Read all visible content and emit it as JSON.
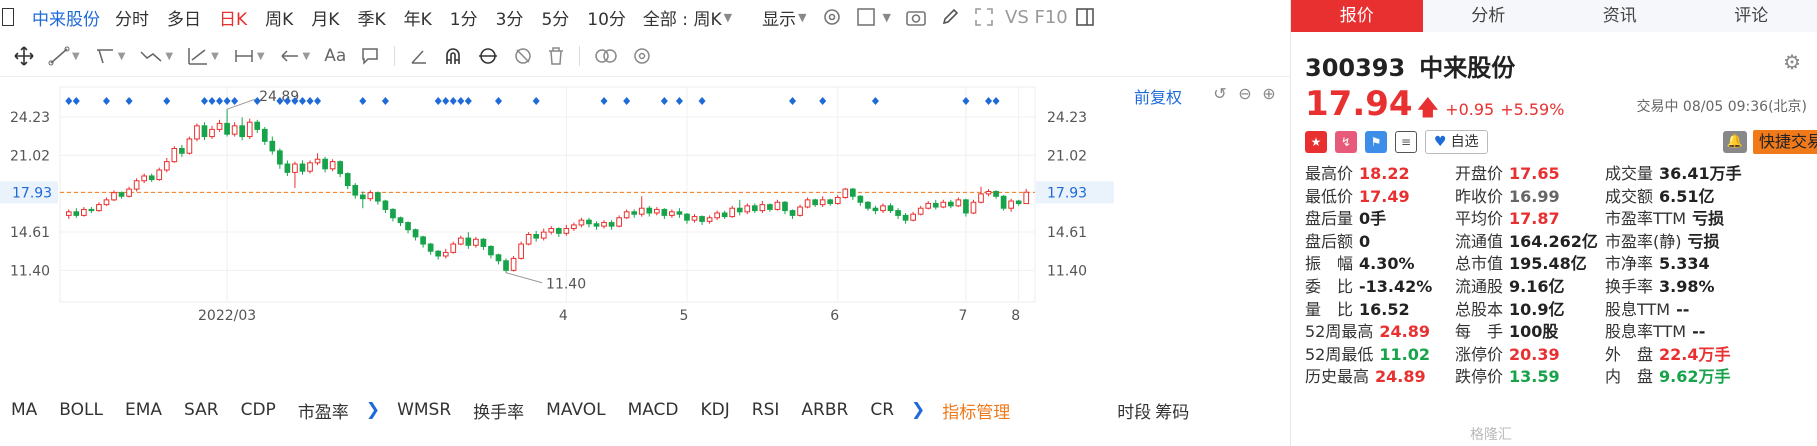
{
  "topbar": {
    "stock_name": "中来股份",
    "tabs": [
      "分时",
      "多日",
      "日K",
      "周K",
      "月K",
      "季K",
      "年K",
      "1分",
      "3分",
      "5分",
      "10分"
    ],
    "active_tab": "日K",
    "period_select": "全部 : 周K",
    "display_select": "显示",
    "vs_label": "VS F10"
  },
  "toolbar": {
    "aa_label": "Aa"
  },
  "chart": {
    "restore_label": "前复权",
    "accent": "#e93030",
    "down_color": "#16a34a",
    "marker_color": "#1e6ad8"
  },
  "chart_data": {
    "type": "candlestick",
    "yticks": [
      "24.23",
      "21.02",
      "17.93",
      "14.61",
      "11.40"
    ],
    "ytick_values": [
      24.23,
      21.02,
      17.93,
      14.61,
      11.4
    ],
    "current_price_label": "17.93",
    "ylim": [
      9.0,
      27.0
    ],
    "xticks": [
      "2022/03",
      "4",
      "5",
      "6",
      "7",
      "8"
    ],
    "annotations": [
      {
        "text": "24.89",
        "value": 24.89
      },
      {
        "text": "11.40",
        "value": 11.4
      }
    ],
    "candles": [
      [
        16.0,
        16.3,
        15.7,
        16.5
      ],
      [
        16.3,
        16.0,
        15.8,
        16.6
      ],
      [
        16.0,
        16.5,
        15.9,
        16.7
      ],
      [
        16.5,
        16.4,
        16.2,
        16.7
      ],
      [
        16.4,
        16.9,
        16.3,
        17.1
      ],
      [
        16.9,
        17.3,
        16.8,
        17.5
      ],
      [
        17.3,
        17.9,
        17.2,
        18.1
      ],
      [
        17.9,
        17.6,
        17.4,
        18.0
      ],
      [
        17.6,
        18.2,
        17.5,
        18.4
      ],
      [
        18.2,
        18.9,
        18.0,
        19.1
      ],
      [
        18.9,
        19.3,
        18.7,
        19.5
      ],
      [
        19.3,
        19.0,
        18.8,
        19.5
      ],
      [
        19.0,
        19.8,
        18.9,
        20.0
      ],
      [
        19.8,
        20.5,
        19.6,
        20.8
      ],
      [
        20.5,
        21.6,
        20.4,
        21.8
      ],
      [
        21.6,
        21.2,
        20.9,
        21.9
      ],
      [
        21.2,
        22.4,
        21.1,
        22.6
      ],
      [
        22.4,
        23.5,
        22.2,
        23.7
      ],
      [
        23.5,
        22.6,
        22.3,
        23.8
      ],
      [
        22.6,
        23.2,
        22.4,
        23.5
      ],
      [
        23.2,
        23.7,
        23.0,
        24.0
      ],
      [
        23.7,
        22.8,
        22.6,
        24.89
      ],
      [
        22.8,
        23.5,
        22.6,
        23.8
      ],
      [
        23.5,
        22.6,
        22.3,
        24.2
      ],
      [
        22.6,
        23.8,
        22.4,
        24.1
      ],
      [
        23.8,
        23.2,
        22.9,
        24.0
      ],
      [
        23.2,
        22.2,
        21.9,
        23.4
      ],
      [
        22.2,
        21.4,
        21.1,
        22.6
      ],
      [
        21.4,
        20.3,
        19.9,
        21.6
      ],
      [
        20.3,
        19.6,
        19.3,
        20.6
      ],
      [
        19.6,
        20.3,
        18.3,
        20.5
      ],
      [
        20.3,
        19.7,
        19.4,
        20.6
      ],
      [
        19.7,
        20.4,
        19.5,
        20.6
      ],
      [
        20.4,
        20.7,
        20.2,
        21.2
      ],
      [
        20.7,
        19.9,
        19.6,
        20.9
      ],
      [
        19.9,
        20.5,
        19.7,
        20.7
      ],
      [
        20.5,
        19.5,
        19.2,
        20.6
      ],
      [
        19.5,
        18.5,
        18.2,
        19.6
      ],
      [
        18.5,
        17.7,
        17.4,
        18.7
      ],
      [
        17.7,
        17.4,
        16.6,
        18.0
      ],
      [
        17.4,
        17.9,
        17.2,
        18.1
      ],
      [
        17.9,
        17.2,
        16.9,
        18.0
      ],
      [
        17.2,
        16.5,
        16.2,
        17.3
      ],
      [
        16.5,
        15.8,
        15.5,
        16.6
      ],
      [
        15.8,
        15.4,
        15.1,
        15.9
      ],
      [
        15.4,
        14.8,
        14.5,
        15.5
      ],
      [
        14.8,
        14.2,
        13.9,
        14.9
      ],
      [
        14.2,
        13.6,
        13.3,
        14.3
      ],
      [
        13.6,
        13.0,
        12.7,
        13.7
      ],
      [
        13.0,
        12.6,
        12.3,
        13.1
      ],
      [
        12.6,
        12.9,
        12.4,
        13.2
      ],
      [
        12.9,
        13.6,
        12.8,
        13.8
      ],
      [
        13.6,
        14.1,
        13.5,
        14.3
      ],
      [
        14.1,
        13.5,
        13.2,
        14.6
      ],
      [
        13.5,
        14.0,
        13.3,
        14.2
      ],
      [
        14.0,
        13.4,
        13.1,
        14.1
      ],
      [
        13.4,
        12.7,
        12.4,
        13.5
      ],
      [
        12.7,
        12.2,
        11.9,
        12.8
      ],
      [
        12.2,
        11.4,
        11.2,
        12.4
      ],
      [
        11.4,
        12.4,
        11.3,
        12.6
      ],
      [
        12.4,
        13.6,
        12.3,
        13.8
      ],
      [
        13.6,
        14.4,
        13.5,
        14.6
      ],
      [
        14.4,
        14.1,
        13.8,
        14.7
      ],
      [
        14.1,
        14.6,
        13.9,
        14.9
      ],
      [
        14.6,
        14.9,
        14.4,
        15.1
      ],
      [
        14.9,
        14.5,
        14.2,
        15.0
      ],
      [
        14.5,
        14.9,
        14.3,
        15.2
      ],
      [
        14.9,
        15.2,
        14.7,
        15.4
      ],
      [
        15.2,
        15.6,
        15.0,
        15.8
      ],
      [
        15.6,
        15.3,
        15.0,
        15.8
      ],
      [
        15.3,
        15.1,
        14.8,
        15.5
      ],
      [
        15.1,
        15.4,
        14.9,
        15.6
      ],
      [
        15.4,
        15.1,
        14.8,
        15.6
      ],
      [
        15.1,
        15.8,
        15.0,
        16.0
      ],
      [
        15.8,
        16.3,
        15.7,
        16.5
      ],
      [
        16.3,
        16.1,
        15.8,
        16.5
      ],
      [
        16.1,
        16.6,
        15.9,
        17.6
      ],
      [
        16.6,
        16.2,
        15.9,
        16.8
      ],
      [
        16.2,
        16.5,
        16.0,
        16.7
      ],
      [
        16.5,
        16.0,
        15.7,
        16.6
      ],
      [
        16.0,
        16.3,
        15.8,
        16.5
      ],
      [
        16.3,
        16.1,
        15.8,
        16.6
      ],
      [
        16.1,
        15.6,
        15.3,
        16.2
      ],
      [
        15.6,
        15.9,
        15.4,
        16.1
      ],
      [
        15.9,
        15.5,
        15.2,
        16.0
      ],
      [
        15.5,
        15.8,
        15.3,
        16.0
      ],
      [
        15.8,
        16.2,
        15.6,
        16.4
      ],
      [
        16.2,
        15.9,
        15.7,
        16.4
      ],
      [
        15.9,
        16.6,
        15.8,
        16.8
      ],
      [
        16.6,
        16.3,
        16.0,
        17.3
      ],
      [
        16.3,
        16.8,
        16.1,
        17.0
      ],
      [
        16.8,
        16.4,
        16.2,
        17.0
      ],
      [
        16.4,
        16.9,
        16.2,
        17.2
      ],
      [
        16.9,
        16.5,
        16.3,
        17.0
      ],
      [
        16.5,
        17.1,
        16.4,
        17.3
      ],
      [
        17.1,
        16.4,
        16.1,
        17.2
      ],
      [
        16.4,
        16.0,
        15.7,
        16.5
      ],
      [
        16.0,
        16.7,
        15.9,
        16.9
      ],
      [
        16.7,
        17.3,
        16.6,
        17.5
      ],
      [
        17.3,
        16.9,
        16.7,
        17.4
      ],
      [
        16.9,
        17.3,
        16.7,
        17.6
      ],
      [
        17.3,
        17.0,
        16.8,
        17.4
      ],
      [
        17.0,
        17.5,
        16.9,
        17.7
      ],
      [
        17.5,
        18.2,
        17.4,
        18.3
      ],
      [
        18.2,
        17.6,
        17.3,
        18.3
      ],
      [
        17.6,
        17.1,
        16.8,
        17.7
      ],
      [
        17.1,
        16.6,
        16.4,
        17.2
      ],
      [
        16.6,
        16.4,
        16.1,
        16.8
      ],
      [
        16.4,
        16.8,
        16.2,
        17.0
      ],
      [
        16.8,
        16.4,
        16.2,
        17.0
      ],
      [
        16.4,
        16.0,
        15.7,
        16.6
      ],
      [
        16.0,
        15.6,
        15.3,
        16.2
      ],
      [
        15.6,
        16.1,
        15.5,
        16.3
      ],
      [
        16.1,
        16.6,
        16.0,
        16.8
      ],
      [
        16.6,
        17.0,
        16.5,
        17.2
      ],
      [
        17.0,
        16.7,
        16.5,
        17.3
      ],
      [
        16.7,
        17.1,
        16.6,
        17.3
      ],
      [
        17.1,
        16.8,
        16.6,
        17.3
      ],
      [
        16.8,
        17.3,
        16.7,
        17.5
      ],
      [
        17.3,
        16.2,
        15.9,
        17.4
      ],
      [
        16.2,
        17.1,
        16.1,
        17.3
      ],
      [
        17.1,
        17.8,
        17.0,
        18.4
      ],
      [
        17.8,
        18.0,
        17.6,
        18.2
      ],
      [
        18.0,
        17.6,
        17.4,
        18.1
      ],
      [
        17.6,
        16.6,
        16.4,
        17.7
      ],
      [
        16.6,
        17.2,
        16.3,
        17.4
      ],
      [
        17.2,
        16.99,
        16.8,
        17.3
      ],
      [
        16.99,
        17.94,
        17.49,
        18.22
      ]
    ]
  },
  "bottombar": {
    "indicators": [
      "MA",
      "BOLL",
      "EMA",
      "SAR",
      "CDP",
      "市盈率",
      "WMSR",
      "换手率",
      "MAVOL",
      "MACD",
      "KDJ",
      "RSI",
      "ARBR",
      "CR"
    ],
    "manage_label": "指标管理",
    "right_links": [
      "时段",
      "筹码"
    ]
  },
  "rightpanel": {
    "tabs": [
      "报价",
      "分析",
      "资讯",
      "评论"
    ],
    "active_tab": "报价",
    "code": "300393",
    "name": "中来股份",
    "price": "17.94",
    "change": "+0.95",
    "change_pct": "+5.59%",
    "status": "交易中 08/05 09:36(北京)",
    "watch_label": "自选",
    "quick_trade_label": "快捷交易",
    "stats": [
      [
        {
          "label": "最高价",
          "value": "18.22",
          "tone": "red"
        },
        {
          "label": "开盘价",
          "value": "17.65",
          "tone": "red"
        },
        {
          "label": "成交量",
          "value": "36.41万手",
          "tone": "dark"
        }
      ],
      [
        {
          "label": "最低价",
          "value": "17.49",
          "tone": "red"
        },
        {
          "label": "昨收价",
          "value": "16.99",
          "tone": "gray"
        },
        {
          "label": "成交额",
          "value": "6.51亿",
          "tone": "dark"
        }
      ],
      [
        {
          "label": "盘后量",
          "value": "0手",
          "tone": "dark"
        },
        {
          "label": "平均价",
          "value": "17.87",
          "tone": "red"
        },
        {
          "label": "市盈率TTM",
          "value": "亏损",
          "tone": "dark"
        }
      ],
      [
        {
          "label": "盘后额",
          "value": "0",
          "tone": "dark"
        },
        {
          "label": "流通值",
          "value": "164.262亿",
          "tone": "dark"
        },
        {
          "label": "市盈率(静)",
          "value": "亏损",
          "tone": "dark"
        }
      ],
      [
        {
          "label": "振　幅",
          "value": "4.30%",
          "tone": "dark"
        },
        {
          "label": "总市值",
          "value": "195.48亿",
          "tone": "dark"
        },
        {
          "label": "市净率",
          "value": "5.334",
          "tone": "dark"
        }
      ],
      [
        {
          "label": "委　比",
          "value": "-13.42%",
          "tone": "dark"
        },
        {
          "label": "流通股",
          "value": "9.16亿",
          "tone": "dark"
        },
        {
          "label": "换手率",
          "value": "3.98%",
          "tone": "dark"
        }
      ],
      [
        {
          "label": "量　比",
          "value": "16.52",
          "tone": "dark"
        },
        {
          "label": "总股本",
          "value": "10.9亿",
          "tone": "dark"
        },
        {
          "label": "股息TTM",
          "value": "--",
          "tone": "dark"
        }
      ],
      [
        {
          "label": "52周最高",
          "value": "24.89",
          "tone": "red"
        },
        {
          "label": "每　手",
          "value": "100股",
          "tone": "dark"
        },
        {
          "label": "股息率TTM",
          "value": "--",
          "tone": "dark"
        }
      ],
      [
        {
          "label": "52周最低",
          "value": "11.02",
          "tone": "green"
        },
        {
          "label": "涨停价",
          "value": "20.39",
          "tone": "red"
        },
        {
          "label": "外　盘",
          "value": "22.4万手",
          "tone": "red"
        }
      ],
      [
        {
          "label": "历史最高",
          "value": "24.89",
          "tone": "red"
        },
        {
          "label": "跌停价",
          "value": "13.59",
          "tone": "green"
        },
        {
          "label": "内　盘",
          "value": "9.62万手",
          "tone": "green"
        }
      ]
    ]
  },
  "watermark": "格隆汇"
}
